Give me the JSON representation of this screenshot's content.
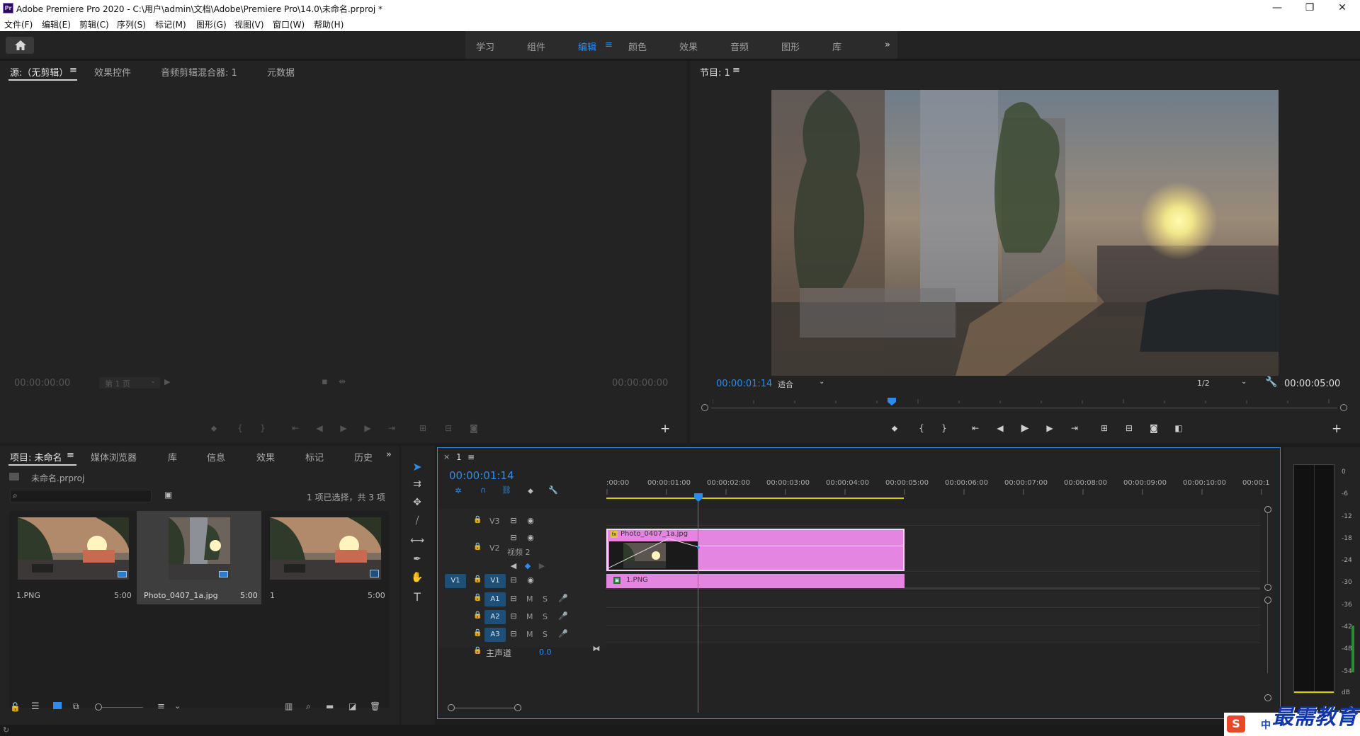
{
  "titlebar": {
    "logo": "Pr",
    "title": "Adobe Premiere Pro 2020 - C:\\用户\\admin\\文档\\Adobe\\Premiere Pro\\14.0\\未命名.prproj *",
    "minimize": "—",
    "maximize": "❐",
    "close": "✕"
  },
  "menubar": [
    "文件(F)",
    "编辑(E)",
    "剪辑(C)",
    "序列(S)",
    "标记(M)",
    "图形(G)",
    "视图(V)",
    "窗口(W)",
    "帮助(H)"
  ],
  "workspaces": {
    "tabs": [
      "学习",
      "组件",
      "编辑",
      "颜色",
      "效果",
      "音频",
      "图形",
      "库"
    ],
    "active": "编辑",
    "more": "»",
    "menu_glyph": "≡"
  },
  "source_panel": {
    "tabs": [
      "源:（无剪辑）",
      "效果控件",
      "音频剪辑混合器: 1",
      "元数据"
    ],
    "menu_glyph": "≡",
    "timecode_in": "00:00:00:00",
    "timecode_out": "00:00:00:00",
    "page_select": "第 1 页"
  },
  "program_panel": {
    "tab": "节目: 1",
    "menu_glyph": "≡",
    "timecode": "00:00:01:14",
    "zoom": "适合",
    "resolution": "1/2",
    "duration": "00:00:05:00",
    "playhead_fraction": 0.29
  },
  "project_panel": {
    "tabs": [
      "项目: 未命名",
      "媒体浏览器",
      "库",
      "信息",
      "效果",
      "标记",
      "历史"
    ],
    "menu_glyph": "≡",
    "file": "未命名.prproj",
    "selection_info": "1 项已选择，共 3 项",
    "items": [
      {
        "name": "1.PNG",
        "duration": "5:00",
        "selected": false
      },
      {
        "name": "Photo_0407_1a.jpg",
        "duration": "5:00",
        "selected": true
      },
      {
        "name": "1",
        "duration": "5:00",
        "selected": false
      }
    ]
  },
  "timeline": {
    "tab": "1",
    "close_glyph": "×",
    "menu_glyph": "≡",
    "timecode": "00:00:01:14",
    "ruler": [
      ":00:00",
      "00:00:01:00",
      "00:00:02:00",
      "00:00:03:00",
      "00:00:04:00",
      "00:00:05:00",
      "00:00:06:00",
      "00:00:07:00",
      "00:00:08:00",
      "00:00:09:00",
      "00:00:10:00",
      "00:00:1"
    ],
    "tracks": {
      "v3": "V3",
      "v2_name": "视频 2",
      "v1": "V1",
      "v1_src": "V1",
      "a1": "A1",
      "a2": "A2",
      "a3": "A3",
      "master": "主声道",
      "master_value": "0.0",
      "mute": "M",
      "solo": "S"
    },
    "clips": {
      "v2": "Photo_0407_1a.jpg",
      "v1": "1.PNG"
    }
  },
  "audio_meter": {
    "labels": [
      "0",
      "-6",
      "-12",
      "-18",
      "-24",
      "-30",
      "-36",
      "-42",
      "-48",
      "-54",
      "dB"
    ]
  },
  "watermark": "最需教育",
  "ime": {
    "logo": "S",
    "lang": "中",
    "punct": "•,"
  },
  "colors": {
    "accent": "#2d8ceb",
    "clip_pink": "#e486e1",
    "track_blue": "#1d4f79",
    "work_area": "#d7d000"
  }
}
